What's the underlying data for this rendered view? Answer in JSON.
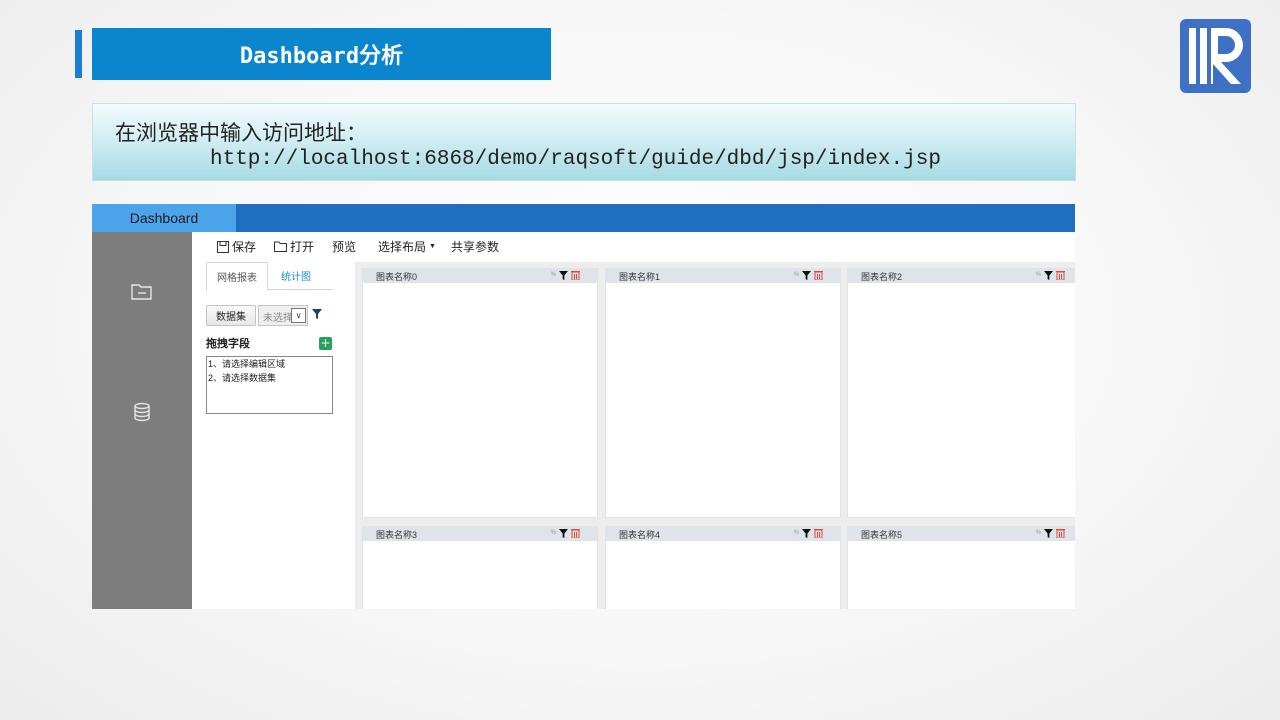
{
  "slide": {
    "title": "Dashboard分析",
    "info_line1": "在浏览器中输入访问地址：",
    "info_line2": "http://localhost:6868/demo/raqsoft/guide/dbd/jsp/index.jsp",
    "logo_icon": "raqsoft-logo-icon",
    "colors": {
      "title_bg": "#0a86cf",
      "accent": "#1a7fd0",
      "logo_bg": "#3e70c4"
    }
  },
  "app": {
    "tab_label": "Dashboard",
    "colors": {
      "topbar": "#1e6fbf",
      "tab": "#4da3ea",
      "sidebar": "#7d7d7d"
    },
    "sidebar": [
      {
        "icon": "folder-icon"
      },
      {
        "icon": "database-icon"
      }
    ],
    "toolbar": {
      "save": "保存",
      "open": "打开",
      "preview": "预览",
      "layout": "选择布局",
      "share": "共享参数"
    },
    "panel": {
      "tabs": [
        "网格报表",
        "统计图"
      ],
      "dataset_button": "数据集",
      "dataset_select": "未选择",
      "drag_title": "拖拽字段",
      "add_label": "+",
      "hints": [
        "1、请选择编辑区域",
        "2、请选择数据集"
      ]
    },
    "cards": [
      {
        "title": "图表名称0",
        "pct": "%"
      },
      {
        "title": "图表名称1",
        "pct": "%"
      },
      {
        "title": "图表名称2",
        "pct": "%"
      },
      {
        "title": "图表名称3",
        "pct": "%"
      },
      {
        "title": "图表名称4",
        "pct": "%"
      },
      {
        "title": "图表名称5",
        "pct": "%"
      }
    ]
  }
}
